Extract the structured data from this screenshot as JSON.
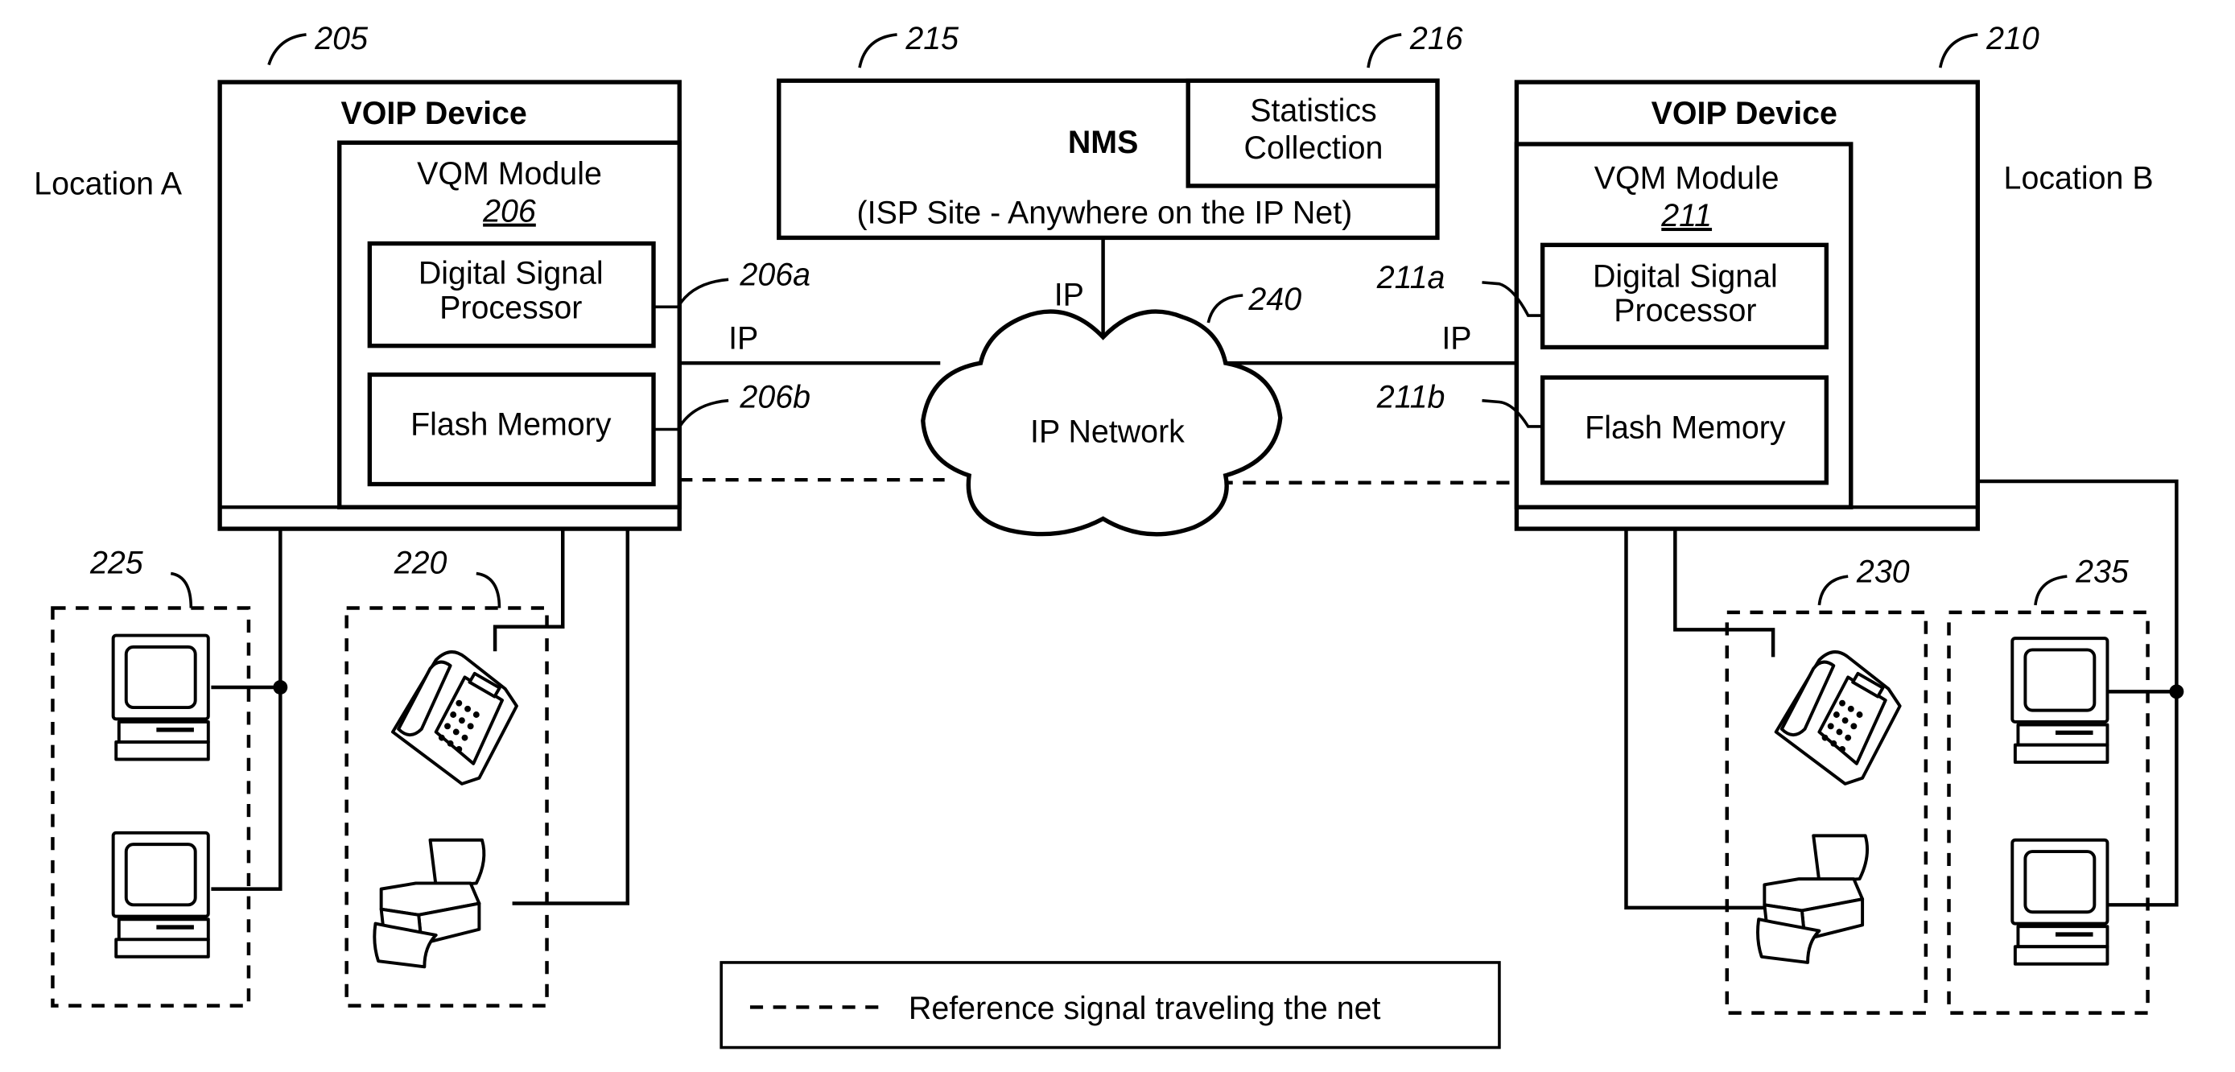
{
  "figure": {
    "location_a": "Location A",
    "location_b": "Location B",
    "device_a": {
      "ref": "205",
      "title": "VOIP Device",
      "module_title": "VQM Module",
      "module_ref": "206",
      "dsp_label_1": "Digital Signal",
      "dsp_label_2": "Processor",
      "dsp_ref": "206a",
      "flash_label": "Flash Memory",
      "flash_ref": "206b",
      "ip_label": "IP"
    },
    "device_b": {
      "ref": "210",
      "title": "VOIP Device",
      "module_title": "VQM Module",
      "module_ref": "211",
      "dsp_label_1": "Digital Signal",
      "dsp_label_2": "Processor",
      "dsp_ref": "211a",
      "flash_label": "Flash Memory",
      "flash_ref": "211b",
      "ip_label": "IP"
    },
    "nms": {
      "ref": "215",
      "title": "NMS",
      "site_label": "(ISP Site - Anywhere on the IP Net)",
      "stats_ref": "216",
      "stats_label_1": "Statistics",
      "stats_label_2": "Collection",
      "ip_label": "IP"
    },
    "network": {
      "ref": "240",
      "label": "IP Network"
    },
    "groups": {
      "a_computers_ref": "225",
      "a_phone_fax_ref": "220",
      "b_phone_fax_ref": "230",
      "b_computers_ref": "235"
    },
    "legend": {
      "label": "Reference signal traveling the net"
    }
  }
}
